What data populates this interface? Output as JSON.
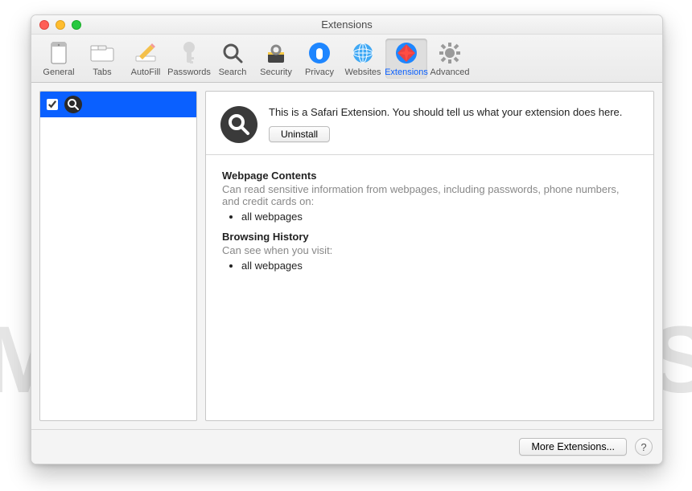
{
  "window": {
    "title": "Extensions"
  },
  "toolbar": {
    "items": [
      {
        "label": "General",
        "icon": "general"
      },
      {
        "label": "Tabs",
        "icon": "tabs"
      },
      {
        "label": "AutoFill",
        "icon": "autofill"
      },
      {
        "label": "Passwords",
        "icon": "passwords"
      },
      {
        "label": "Search",
        "icon": "search"
      },
      {
        "label": "Security",
        "icon": "security"
      },
      {
        "label": "Privacy",
        "icon": "privacy"
      },
      {
        "label": "Websites",
        "icon": "websites"
      },
      {
        "label": "Extensions",
        "icon": "extensions",
        "selected": true
      },
      {
        "label": "Advanced",
        "icon": "advanced"
      }
    ]
  },
  "sidebar": {
    "items": [
      {
        "checked": true,
        "icon": "magnifier"
      }
    ]
  },
  "details": {
    "description": "This is a Safari Extension. You should tell us what your extension does here.",
    "uninstall_label": "Uninstall",
    "permissions": {
      "webpage_contents": {
        "heading": "Webpage Contents",
        "text": "Can read sensitive information from webpages, including passwords, phone numbers, and credit cards on:",
        "bullets": [
          "all webpages"
        ]
      },
      "browsing_history": {
        "heading": "Browsing History",
        "text": "Can see when you visit:",
        "bullets": [
          "all webpages"
        ]
      }
    }
  },
  "footer": {
    "more_extensions_label": "More Extensions...",
    "help_label": "?"
  },
  "watermark": "MALWARETIPS"
}
